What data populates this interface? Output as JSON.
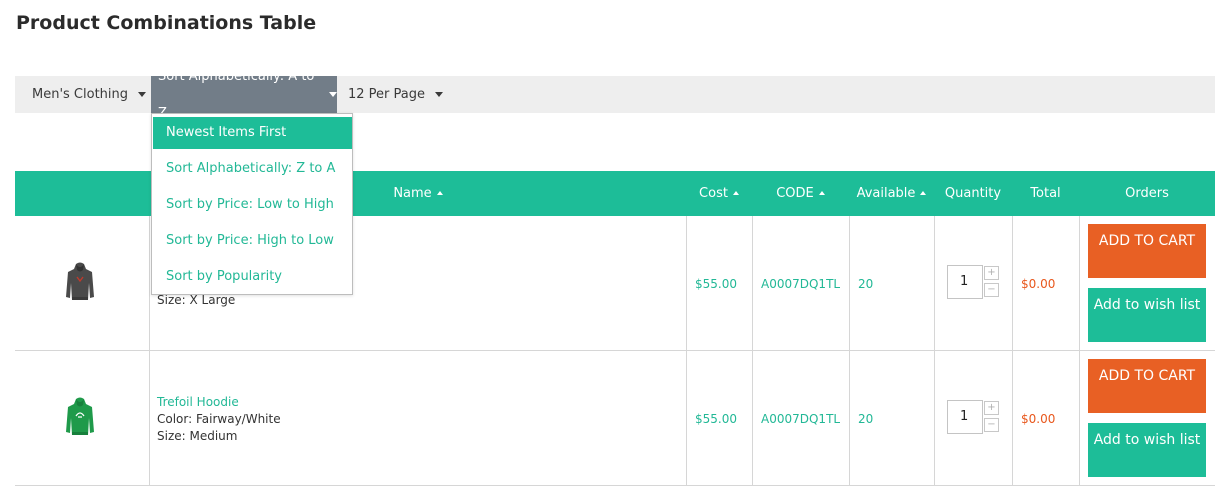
{
  "page": {
    "title": "Product Combinations Table"
  },
  "filters": {
    "category": "Men's Clothing",
    "sort": "Sort Alphabetically: A to Z",
    "per_page": "12 Per Page"
  },
  "sort_dropdown": {
    "options": [
      {
        "label": "Newest Items First",
        "selected": true
      },
      {
        "label": "Sort Alphabetically: Z to A",
        "selected": false
      },
      {
        "label": "Sort by Price: Low to High",
        "selected": false
      },
      {
        "label": "Sort by Price: High to Low",
        "selected": false
      },
      {
        "label": "Sort by Popularity",
        "selected": false
      }
    ]
  },
  "table": {
    "headers": {
      "name": "Name",
      "cost": "Cost",
      "code": "CODE",
      "available": "Available",
      "quantity": "Quantity",
      "total": "Total",
      "orders": "Orders"
    },
    "rows": [
      {
        "image_icon": "dark-gray-hoodie-icon",
        "name": "",
        "color": "",
        "size": "Size: X Large",
        "cost": "$55.00",
        "code": "A0007DQ1TL",
        "available": "20",
        "quantity": "1",
        "total": "$0.00",
        "add_to_cart": "ADD TO CART",
        "add_to_wishlist": "Add to wish list"
      },
      {
        "image_icon": "green-hoodie-icon",
        "name": "Trefoil Hoodie",
        "color": "Color: Fairway/White",
        "size": "Size: Medium",
        "cost": "$55.00",
        "code": "A0007DQ1TL",
        "available": "20",
        "quantity": "1",
        "total": "$0.00",
        "add_to_cart": "ADD TO CART",
        "add_to_wishlist": "Add to wish list"
      }
    ],
    "stepper": {
      "plus": "+",
      "minus": "−"
    }
  },
  "colors": {
    "accent": "#1dbd98",
    "cart_button": "#e86024",
    "active_filter": "#727d88",
    "total_text": "#e8571c"
  }
}
